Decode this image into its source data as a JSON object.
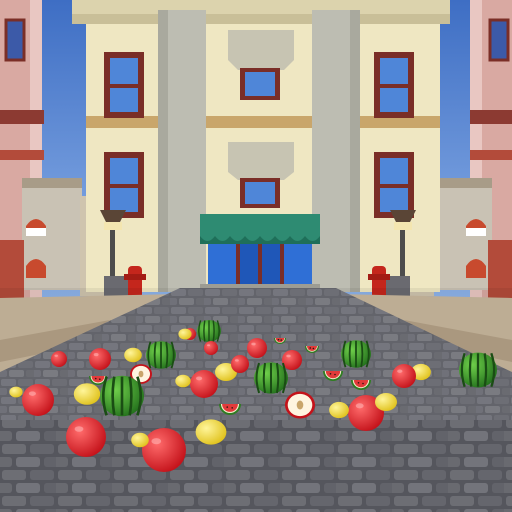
{
  "scene": {
    "type": "3d-street-game-view",
    "palette": {
      "sky": "#4a79c9",
      "building": "#efe7c2",
      "trim": "#c9a66b",
      "column": "#bdbdb2",
      "awning": "#2e8b72",
      "storefront": "#2f6fd6",
      "brick_red": "#b34b3a",
      "road": "#6d6e74",
      "sidewalk": "#c9b89e"
    }
  },
  "fruits": {
    "kinds": [
      "watermelon",
      "red-apple",
      "lemon",
      "watermelon-slice",
      "apple-half"
    ]
  }
}
